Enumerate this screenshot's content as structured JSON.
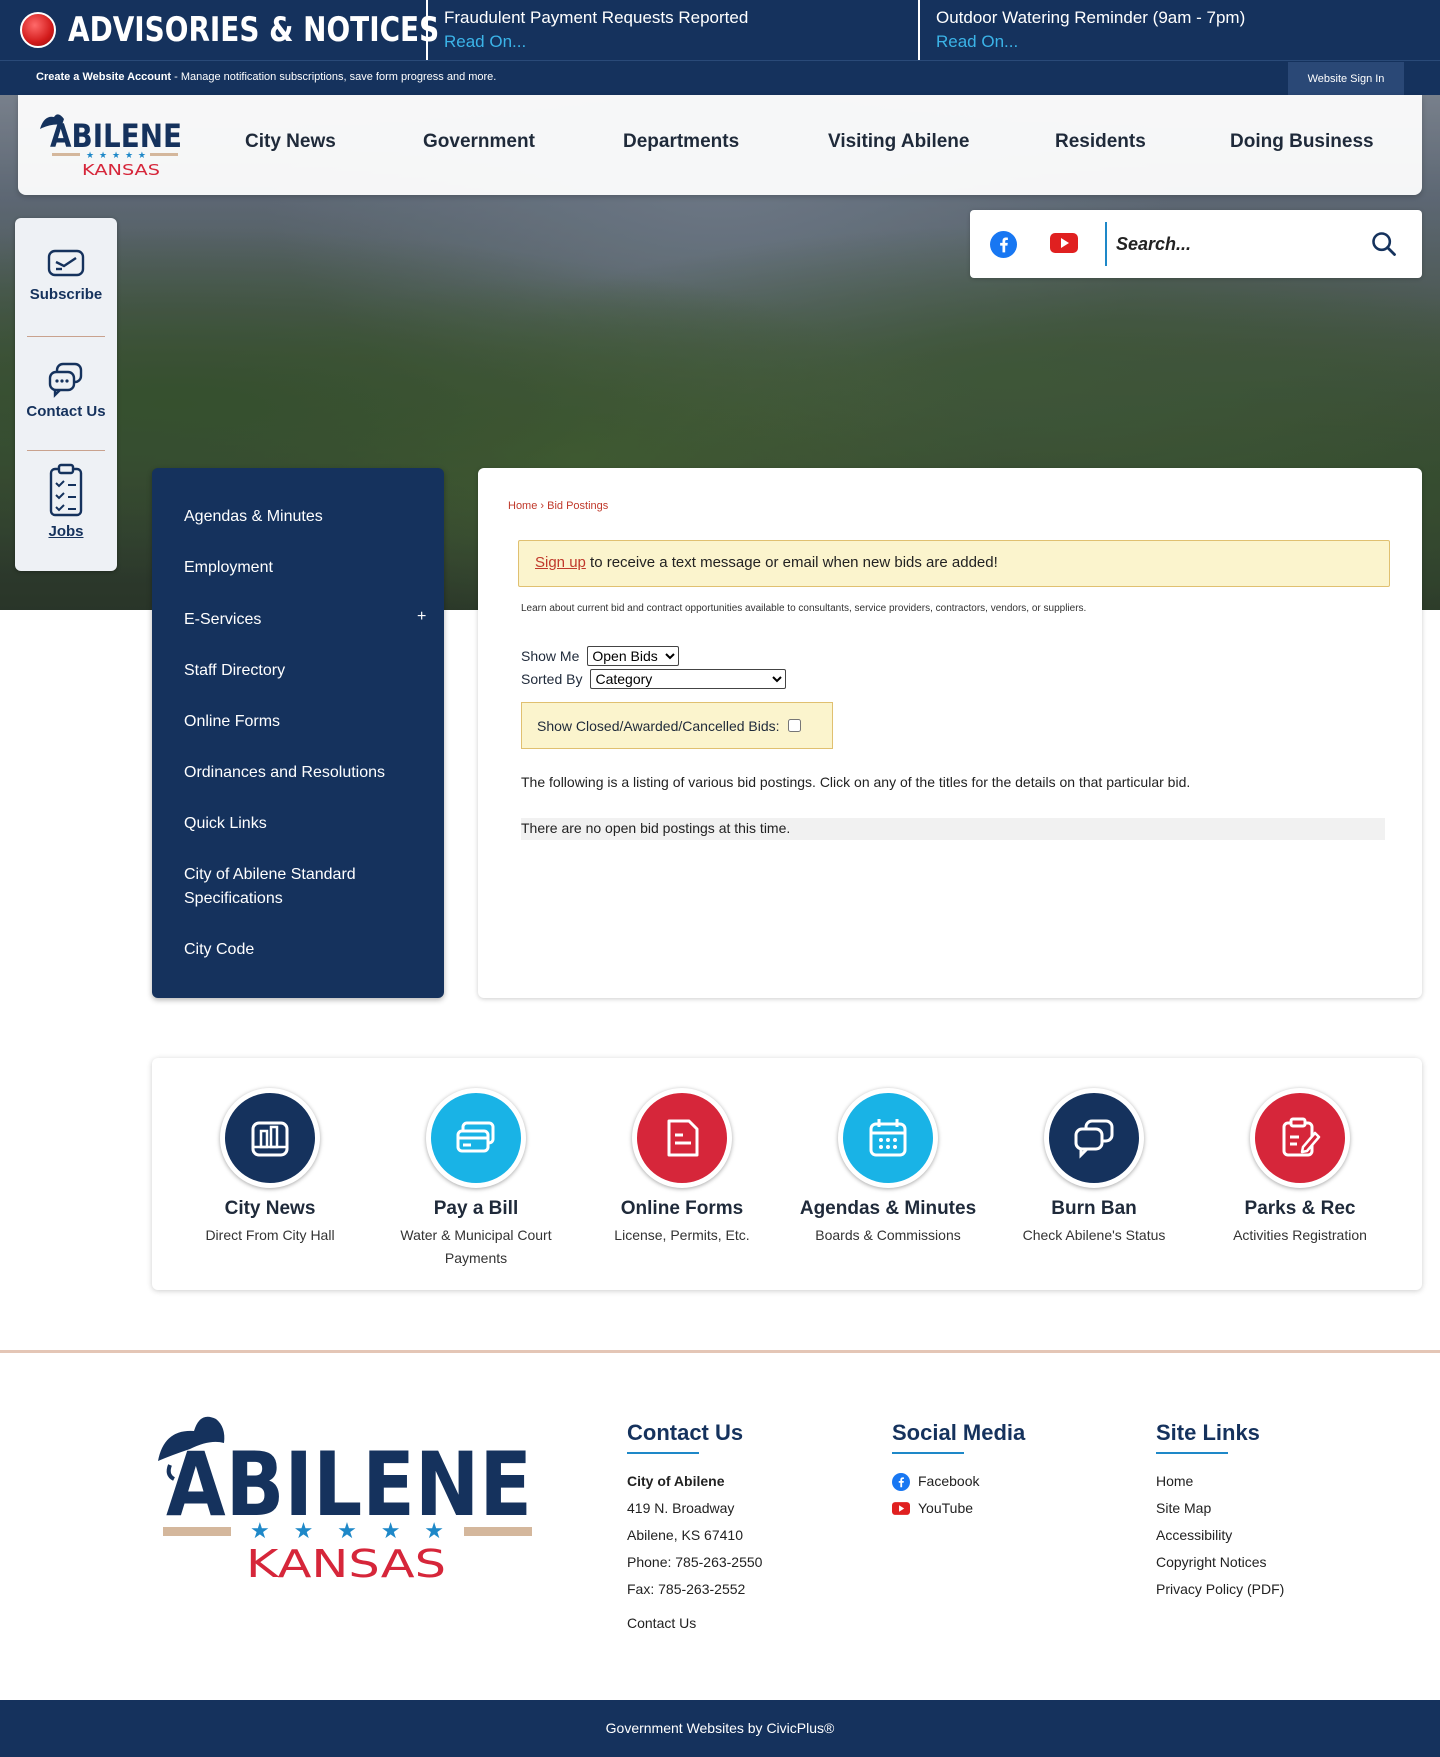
{
  "advisory": {
    "title": "ADVISORIES & NOTICES",
    "items": [
      {
        "headline": "Fraudulent Payment Requests Reported",
        "link": "Read On..."
      },
      {
        "headline": "Outdoor Watering Reminder (9am - 7pm)",
        "link": "Read On..."
      }
    ]
  },
  "account_bar": {
    "create_link": "Create a Website Account",
    "message": " - Manage notification subscriptions, save form progress and more.",
    "signin": "Website Sign In"
  },
  "logo": {
    "name": "ABILENE",
    "state": "KANSAS"
  },
  "nav": [
    "City News",
    "Government",
    "Departments",
    "Visiting Abilene",
    "Residents",
    "Doing Business"
  ],
  "search": {
    "placeholder": "Search..."
  },
  "quick_side": [
    "Subscribe",
    "Contact Us",
    "Jobs"
  ],
  "side_nav": [
    "Agendas & Minutes",
    "Employment",
    "E-Services",
    "Staff Directory",
    "Online Forms",
    "Ordinances and Resolutions",
    "Quick Links",
    "City of Abilene Standard Specifications",
    "City Code"
  ],
  "side_nav_expand": "+",
  "breadcrumb": {
    "home": "Home",
    "sep": " › ",
    "current": "Bid Postings"
  },
  "signup": {
    "link": "Sign up",
    "text": " to receive a text message or email when new bids are added!"
  },
  "intro": "Learn about current bid and contract opportunities available to consultants, service providers, contractors, vendors, or suppliers.",
  "filters": {
    "show_me_label": "Show Me",
    "show_me_value": "Open Bids",
    "sorted_by_label": "Sorted By",
    "sorted_by_value": "Category",
    "closed_label": "Show Closed/Awarded/Cancelled Bids:"
  },
  "listing_text": "The following is a listing of various bid postings. Click on any of the titles for the details on that particular bid.",
  "no_bids": "There are no open bid postings at this time.",
  "tiles": [
    {
      "title": "City News",
      "sub": "Direct From City Hall",
      "color": "#15325d",
      "icon": "building-icon"
    },
    {
      "title": "Pay a Bill",
      "sub": "Water & Municipal Court Payments",
      "color": "#19b3e6",
      "icon": "credit-card-icon"
    },
    {
      "title": "Online Forms",
      "sub": "License, Permits, Etc.",
      "color": "#d6263a",
      "icon": "form-icon"
    },
    {
      "title": "Agendas & Minutes",
      "sub": "Boards & Commissions",
      "color": "#19b3e6",
      "icon": "calendar-icon"
    },
    {
      "title": "Burn Ban",
      "sub": "Check Abilene's Status",
      "color": "#15325d",
      "icon": "chat-icon"
    },
    {
      "title": "Parks & Rec",
      "sub": "Activities Registration",
      "color": "#d6263a",
      "icon": "clipboard-edit-icon"
    }
  ],
  "footer": {
    "contact_heading": "Contact Us",
    "org": "City of Abilene",
    "address1": "419 N. Broadway",
    "address2": "Abilene, KS 67410",
    "phone": "Phone: 785-263-2550",
    "fax": "Fax: 785-263-2552",
    "contact_link": "Contact Us",
    "social_heading": "Social Media",
    "social": [
      "Facebook",
      "YouTube"
    ],
    "links_heading": "Site Links",
    "links": [
      "Home",
      "Site Map",
      "Accessibility",
      "Copyright Notices",
      "Privacy Policy (PDF)"
    ]
  },
  "credit": "Government Websites by CivicPlus®",
  "colors": {
    "navy": "#15325d",
    "red": "#d6263a",
    "cyan": "#19b3e6",
    "accent_blue": "#1e88c8"
  }
}
